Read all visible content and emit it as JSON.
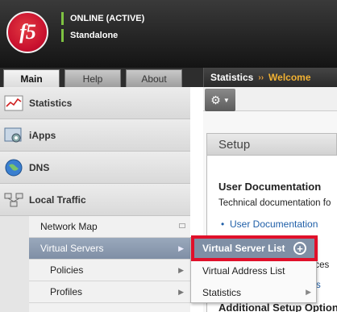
{
  "header": {
    "logo_text": "f5",
    "status": "ONLINE (ACTIVE)",
    "mode": "Standalone"
  },
  "tabs": [
    {
      "label": "Main",
      "active": true
    },
    {
      "label": "Help",
      "active": false
    },
    {
      "label": "About",
      "active": false
    }
  ],
  "breadcrumb": {
    "section": "Statistics",
    "separator": "››",
    "page": "Welcome"
  },
  "sidebar": {
    "items": [
      {
        "label": "Statistics",
        "icon": "statistics-chart-icon"
      },
      {
        "label": "iApps",
        "icon": "iapps-gear-icon"
      },
      {
        "label": "DNS",
        "icon": "dns-globe-icon"
      },
      {
        "label": "Local Traffic",
        "icon": "local-traffic-icon"
      }
    ],
    "subitems": [
      {
        "label": "Network Map"
      },
      {
        "label": "Virtual Servers",
        "selected": true
      },
      {
        "label": "Policies"
      },
      {
        "label": "Profiles"
      }
    ]
  },
  "toolbar": {
    "gear_icon": "gear-icon"
  },
  "main": {
    "setup_title": "Setup",
    "doc_title": "User Documentation",
    "doc_desc": "Technical documentation fo",
    "doc_link": "User Documentation",
    "fragment1": "nces",
    "fragment2": "s",
    "additional_title": "Additional Setup Option"
  },
  "flyout": {
    "items": [
      {
        "label": "Virtual Server List",
        "highlighted": true
      },
      {
        "label": "Virtual Address List"
      },
      {
        "label": "Statistics"
      }
    ]
  },
  "colors": {
    "header_bg": "#1e1e1e",
    "status_green": "#7ec242",
    "crumb_accent": "#f2b233",
    "selected_blue": "#7f8fa5",
    "highlight_red": "#e0102a",
    "link_blue": "#1f5fa8"
  }
}
